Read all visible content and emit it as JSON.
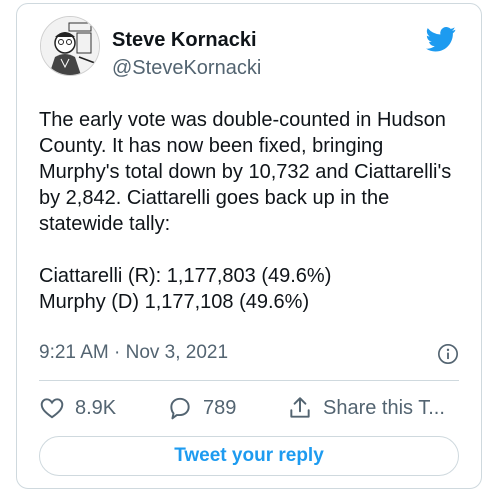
{
  "author": {
    "name": "Steve Kornacki",
    "handle": "@SteveKornacki",
    "avatar_icon": "cartoon-avatar-icon"
  },
  "tweet": {
    "text": "The early vote was double-counted in Hudson County. It has now been fixed, bringing Murphy's total down by 10,732 and Ciattarelli's by 2,842. Ciattarelli goes back up in the statewide tally:",
    "tally_line_1": "Ciattarelli (R): 1,177,803 (49.6%)",
    "tally_line_2": "Murphy (D) 1,177,108  (49.6%)",
    "timestamp": "9:21 AM · Nov 3, 2021"
  },
  "actions": {
    "likes": "8.9K",
    "replies": "789",
    "share_label": "Share this T..."
  },
  "reply_button": "Tweet your reply",
  "colors": {
    "accent": "#1d9bf0",
    "muted": "#536471",
    "border": "#cfd9de"
  }
}
